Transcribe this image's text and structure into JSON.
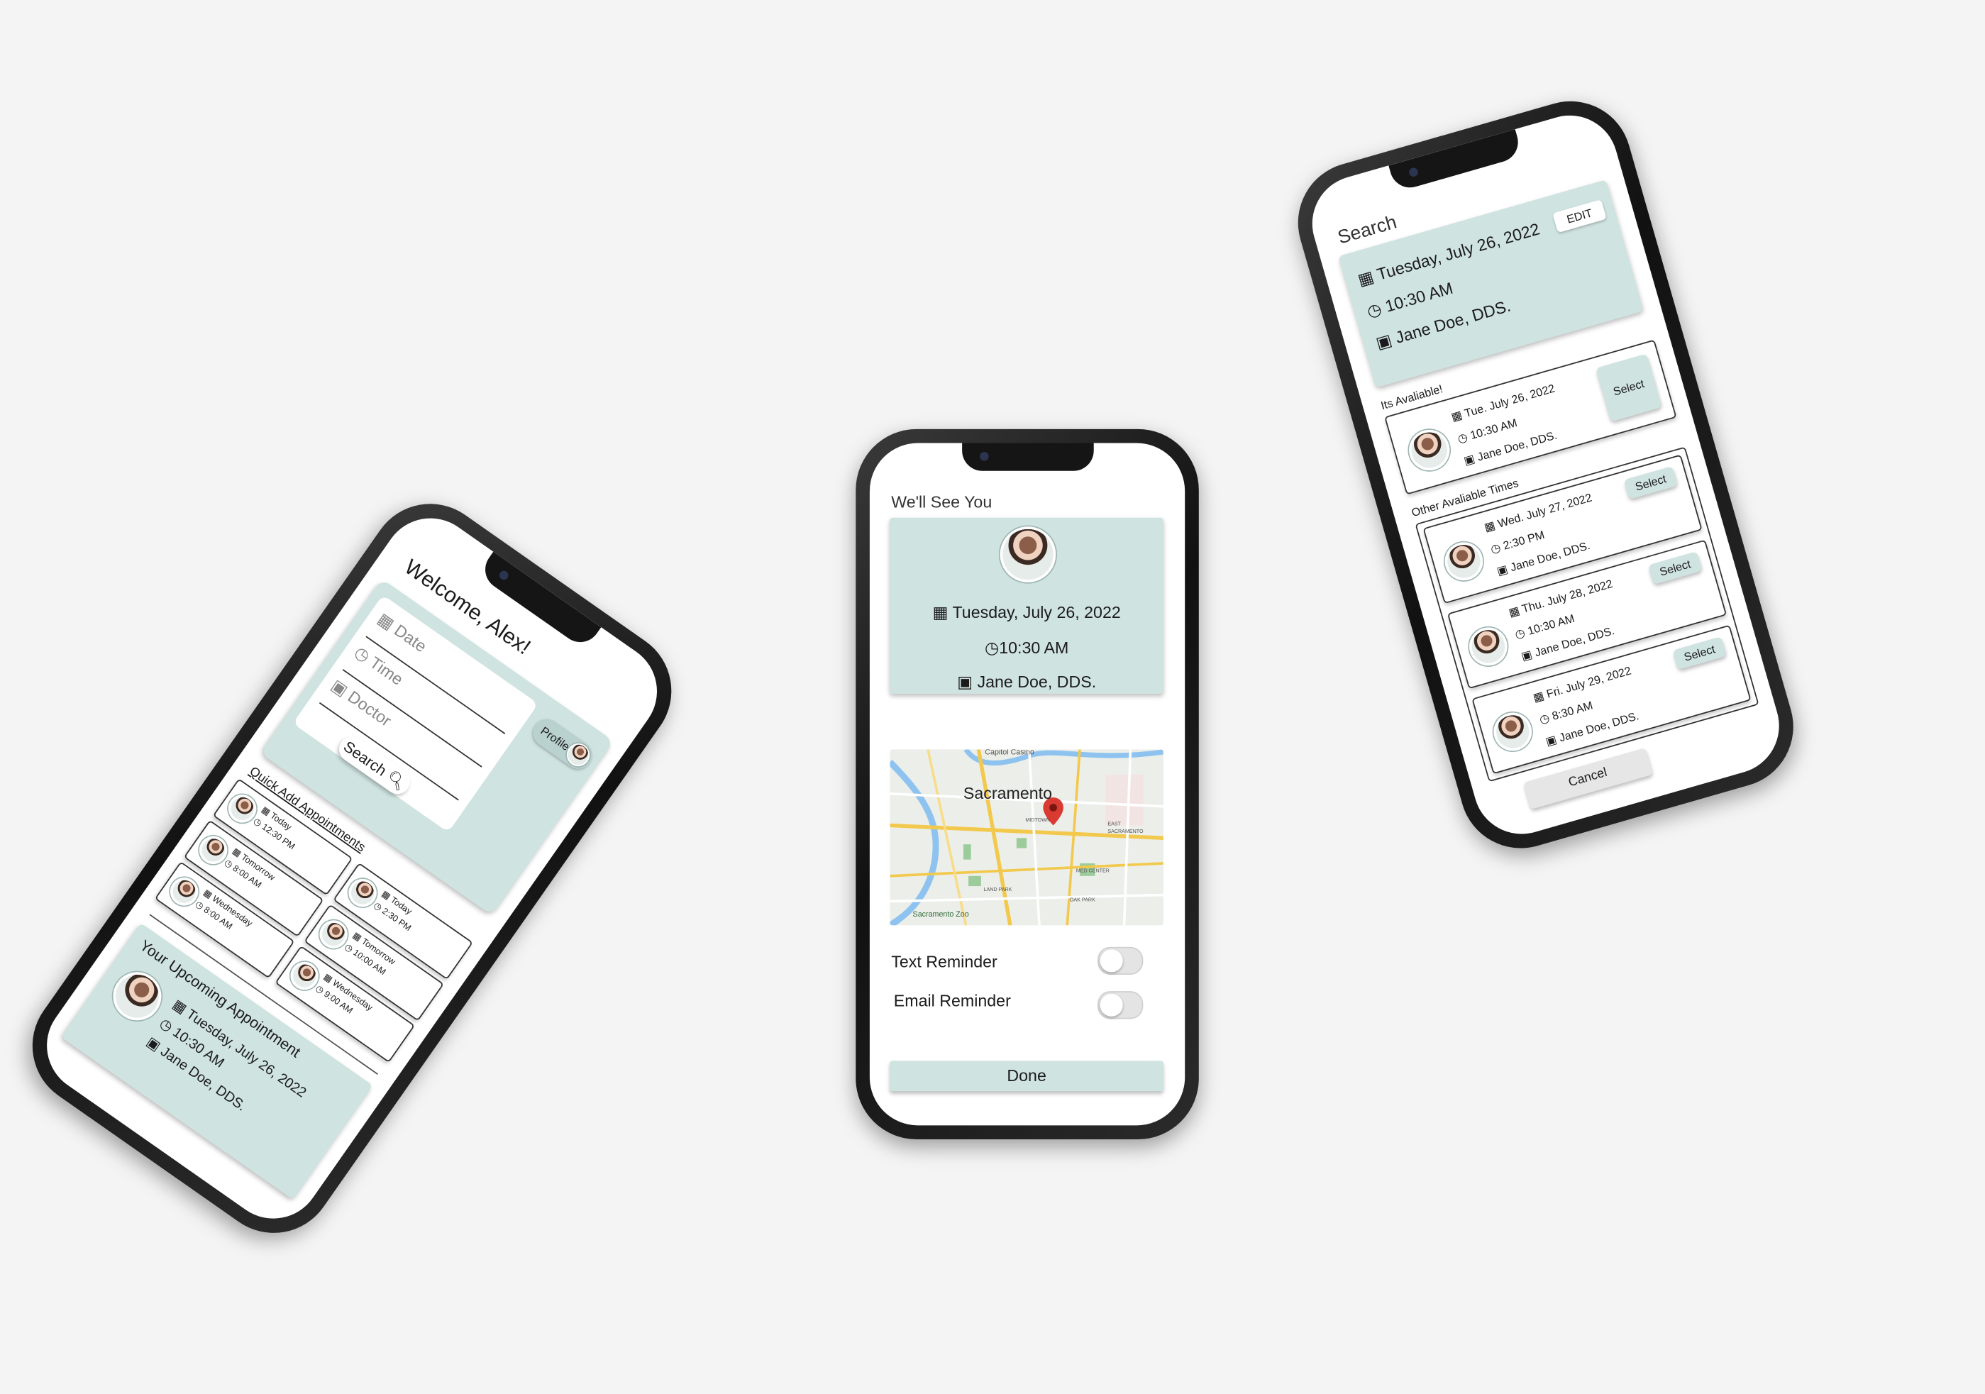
{
  "home": {
    "welcome": "Welcome, Alex!",
    "profile_label": "Profile",
    "date_placeholder": "Date",
    "time_placeholder": "Time",
    "doctor_placeholder": "Doctor",
    "search_label": "Search",
    "quick_add_title": "Quick Add Appointments",
    "quick_add": [
      {
        "day": "Today",
        "time": "12:30 PM"
      },
      {
        "day": "Tomorrow",
        "time": "8:00 AM"
      },
      {
        "day": "Wednesday",
        "time": "8:00 AM"
      },
      {
        "day": "Today",
        "time": "2:30 PM"
      },
      {
        "day": "Tomorrow",
        "time": "10:00 AM"
      },
      {
        "day": "Wednesday",
        "time": "9:00 AM"
      }
    ],
    "upcoming_title": "Your Upcoming Appointment",
    "upcoming_date": "Tuesday, July 26, 2022",
    "upcoming_time": "10:30 AM",
    "upcoming_doctor": "Jane Doe, DDS."
  },
  "confirm": {
    "title": "We'll See You",
    "date": "Tuesday, July 26, 2022",
    "time": "10:30 AM",
    "doctor": "Jane Doe, DDS.",
    "map": {
      "city": "Sacramento",
      "labels": [
        "Capitol Casino",
        "MIDTOWN",
        "EAST SACRAMENTO",
        "MED CENTER",
        "LAND PARK",
        "OAK PARK",
        "Sacramento Zoo"
      ]
    },
    "text_reminder": "Text Reminder",
    "email_reminder": "Email Reminder",
    "done": "Done"
  },
  "search": {
    "title": "Search",
    "date": "Tuesday, July 26, 2022",
    "time": "10:30 AM",
    "doctor": "Jane Doe, DDS.",
    "edit": "EDIT",
    "available_title": "Its Avaliable!",
    "available": {
      "date": "Tue. July 26, 2022",
      "time": "10:30 AM",
      "doctor": "Jane Doe, DDS.",
      "select": "Select"
    },
    "other_title": "Other Avaliable Times",
    "others": [
      {
        "date": "Wed. July 27, 2022",
        "time": "2:30 PM",
        "doctor": "Jane Doe, DDS.",
        "select": "Select"
      },
      {
        "date": "Thu. July 28, 2022",
        "time": "10:30 AM",
        "doctor": "Jane Doe, DDS.",
        "select": "Select"
      },
      {
        "date": "Fri. July 29, 2022",
        "time": "8:30 AM",
        "doctor": "Jane Doe, DDS.",
        "select": "Select"
      }
    ],
    "cancel": "Cancel"
  },
  "icons": {
    "calendar": "calendar-icon",
    "clock": "clock-icon",
    "doctor": "doctor-badge-icon",
    "search": "search-icon",
    "map_pin": "map-pin-icon"
  },
  "colors": {
    "accent": "#cfe3e1",
    "background": "#f4f4f4",
    "pin": "#d93a32"
  }
}
